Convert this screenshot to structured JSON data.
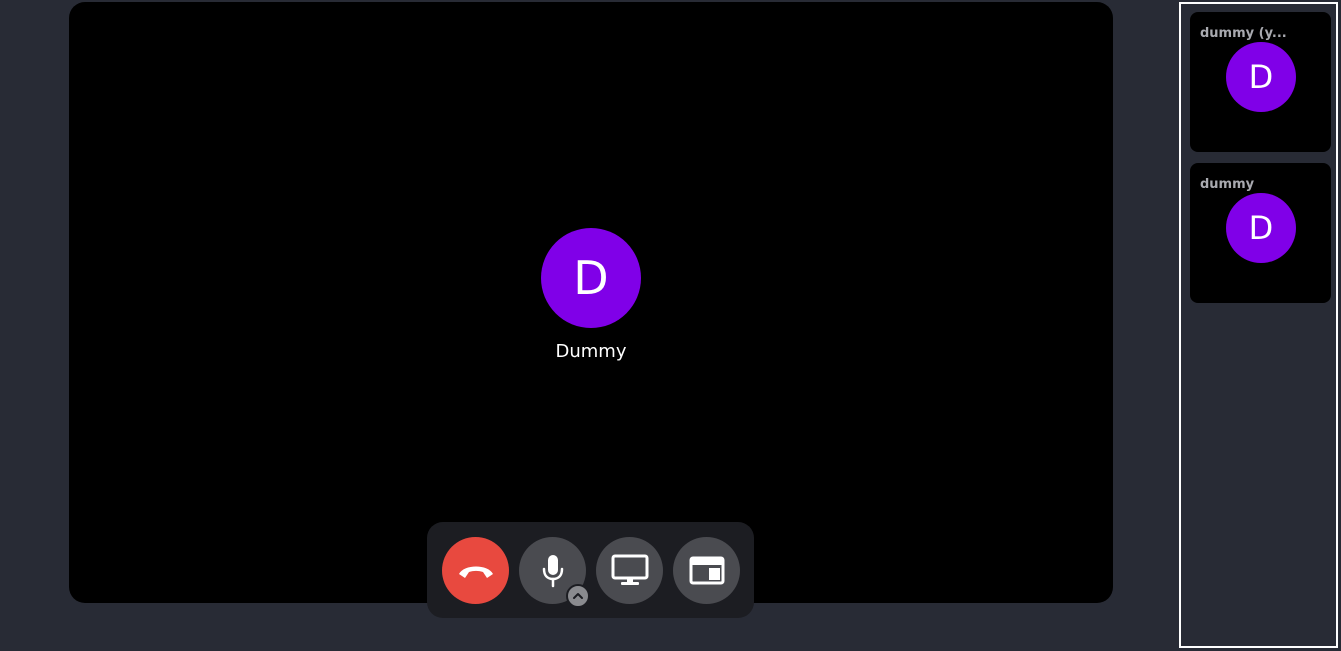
{
  "colors": {
    "background": "#282b35",
    "stage": "#000000",
    "avatar": "#8000e8",
    "hangup": "#e8493f",
    "control_button": "#4a4b50",
    "control_bar": "#1c1d22",
    "tile_name": "#a9aab0"
  },
  "main": {
    "avatar_initial": "D",
    "participant_name": "Dummy"
  },
  "controls": {
    "hangup_icon": "phone-hangup-icon",
    "mic_icon": "microphone-icon",
    "mic_options_icon": "chevron-up-icon",
    "screen_icon": "monitor-icon",
    "layout_icon": "layout-icon"
  },
  "sidebar": {
    "tiles": [
      {
        "name": "dummy (y...",
        "initial": "D"
      },
      {
        "name": "dummy",
        "initial": "D"
      }
    ]
  }
}
